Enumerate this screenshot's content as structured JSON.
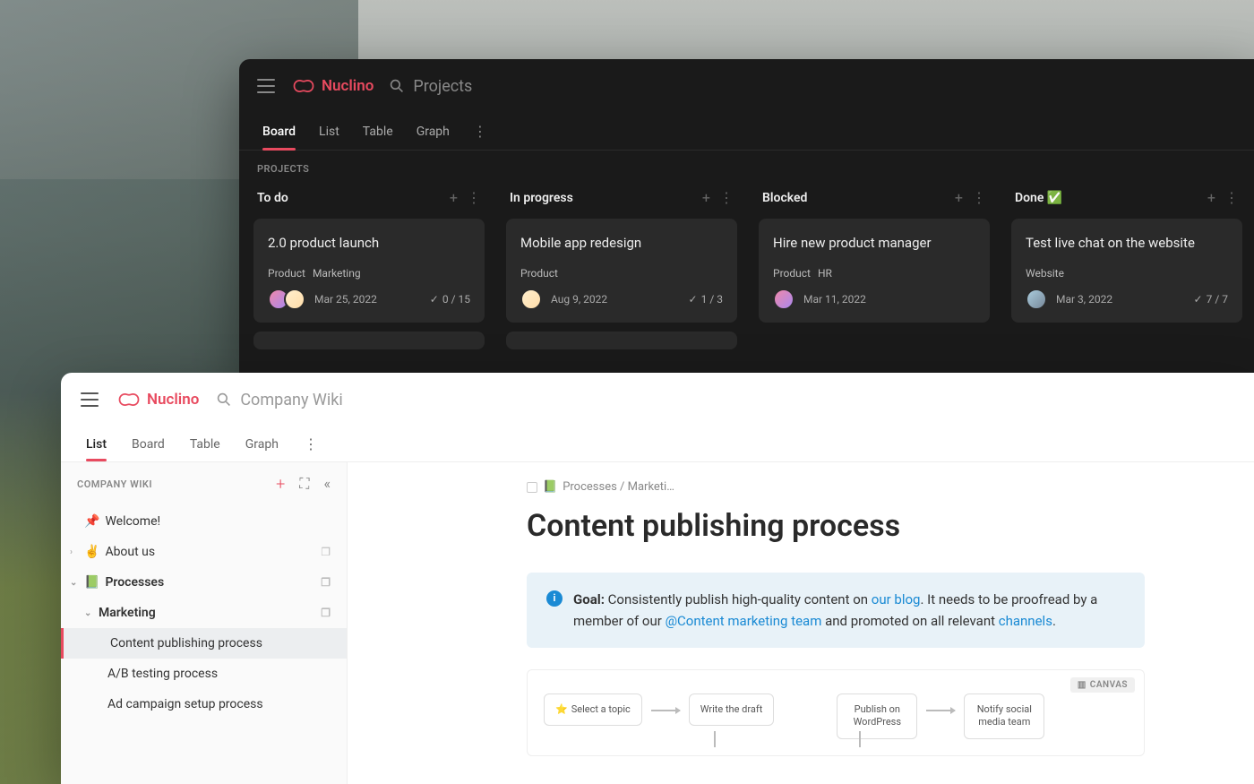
{
  "brand": "Nuclino",
  "dark": {
    "search_placeholder": "Projects",
    "tabs": [
      "Board",
      "List",
      "Table",
      "Graph"
    ],
    "active_tab": "Board",
    "section_label": "PROJECTS",
    "columns": [
      {
        "title": "To do",
        "card": {
          "title": "2.0 product launch",
          "tags": [
            "Product",
            "Marketing"
          ],
          "date": "Mar 25, 2022",
          "count": "0 / 15",
          "avatars": 2
        }
      },
      {
        "title": "In progress",
        "card": {
          "title": "Mobile app redesign",
          "tags": [
            "Product"
          ],
          "date": "Aug 9, 2022",
          "count": "1 / 3",
          "avatars": 1
        }
      },
      {
        "title": "Blocked",
        "card": {
          "title": "Hire new product manager",
          "tags": [
            "Product",
            "HR"
          ],
          "date": "Mar 11, 2022",
          "count": "",
          "avatars": 1
        }
      },
      {
        "title": "Done ✅",
        "card": {
          "title": "Test live chat on the website",
          "tags": [
            "Website"
          ],
          "date": "Mar 3, 2022",
          "count": "7 / 7",
          "avatars": 1
        }
      }
    ]
  },
  "light": {
    "search_placeholder": "Company Wiki",
    "tabs": [
      "List",
      "Board",
      "Table",
      "Graph"
    ],
    "active_tab": "List",
    "sidebar_label": "COMPANY WIKI",
    "tree": {
      "welcome": "Welcome!",
      "about": "About us",
      "processes": "Processes",
      "marketing": "Marketing",
      "content_pub": "Content publishing process",
      "ab_test": "A/B testing process",
      "ad_campaign": "Ad campaign setup process"
    },
    "breadcrumb": "Processes / Marketi…",
    "page_title": "Content publishing process",
    "callout": {
      "goal_label": "Goal:",
      "text1": " Consistently publish high-quality content on ",
      "link1": "our blog",
      "text2": ". It needs to be proofread by a member of our ",
      "link2": "@Content marketing team",
      "text3": " and promoted on all relevant ",
      "link3": "channels",
      "text4": "."
    },
    "canvas_badge": "CANVAS",
    "flow": {
      "n1": "Select a topic",
      "n2": "Write the draft",
      "n3": "Publish on WordPress",
      "n4": "Notify social media team"
    }
  }
}
